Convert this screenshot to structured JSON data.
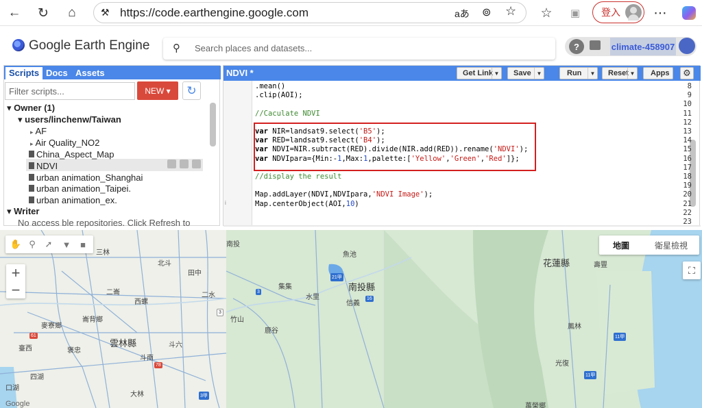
{
  "browser": {
    "url": "https://code.earthengine.google.com",
    "login_label": "登入",
    "read_aloud_glyph": "aあ"
  },
  "app": {
    "title": "Google Earth Engine",
    "search_placeholder": "Search places and datasets...",
    "help_glyph": "?",
    "project": "climate-458907"
  },
  "scripts_panel": {
    "tabs": [
      "Scripts",
      "Docs",
      "Assets"
    ],
    "filter_placeholder": "Filter scripts...",
    "new_label": "NEW",
    "tree": [
      {
        "label": "Owner (1)",
        "level": 0,
        "type": "section",
        "expanded": true
      },
      {
        "label": "users/linchenw/Taiwan",
        "level": 1,
        "type": "repo",
        "expanded": true
      },
      {
        "label": "AF",
        "level": 2,
        "type": "folder"
      },
      {
        "label": "Air Quality_NO2",
        "level": 2,
        "type": "folder"
      },
      {
        "label": "China_Aspect_Map",
        "level": 2,
        "type": "file"
      },
      {
        "label": "NDVI",
        "level": 2,
        "type": "file",
        "selected": true
      },
      {
        "label": "urban animation_Shanghai",
        "level": 2,
        "type": "file"
      },
      {
        "label": "urban animation_Taipei.",
        "level": 2,
        "type": "file"
      },
      {
        "label": "urban animation_ex.",
        "level": 2,
        "type": "file"
      },
      {
        "label": "Writer",
        "level": 0,
        "type": "section",
        "expanded": true
      },
      {
        "label": "No access ble repositories. Click Refresh to",
        "level": 1,
        "type": "note"
      }
    ]
  },
  "editor": {
    "title": "NDVI *",
    "buttons": [
      "Get Link",
      "Save",
      "Run",
      "Reset",
      "Apps"
    ],
    "lines": [
      {
        "n": "8",
        "code": ".mean()"
      },
      {
        "n": "9",
        "code": ".clip(AOI);"
      },
      {
        "n": "10",
        "code": ""
      },
      {
        "n": "11",
        "code": "//Caculate NDVI"
      },
      {
        "n": "12",
        "code": ""
      },
      {
        "n": "13",
        "code": "var NIR=landsat9.select('B5');"
      },
      {
        "n": "14",
        "code": "var RED=landsat9.select('B4');"
      },
      {
        "n": "15",
        "code": "var NDVI=NIR.subtract(RED).divide(NIR.add(RED)).rename('NDVI');"
      },
      {
        "n": "16",
        "code": "var NDVIpara={Min:-1,Max:1,palette:['Yellow','Green','Red']};"
      },
      {
        "n": "17",
        "code": ""
      },
      {
        "n": "18",
        "code": "//display the result"
      },
      {
        "n": "19",
        "code": ""
      },
      {
        "n": "20",
        "code": "Map.addLayer(NDVI,NDVIpara,'NDVI Image');"
      },
      {
        "n": "21",
        "code": "Map.centerObject(AOI,10)"
      },
      {
        "n": "22",
        "code": ""
      },
      {
        "n": "23",
        "code": ""
      }
    ],
    "info_marker_line": "21",
    "highlighted_lines": [
      "13",
      "16"
    ]
  },
  "map": {
    "type_buttons": [
      "地圖",
      "衛星檢視"
    ],
    "active_type": "地圖",
    "labels": [
      {
        "text": "南投縣",
        "big": true
      },
      {
        "text": "花蓮縣",
        "big": true
      },
      {
        "text": "雲林縣",
        "big": true
      },
      {
        "text": "三林"
      },
      {
        "text": "北斗"
      },
      {
        "text": "田中"
      },
      {
        "text": "二崙"
      },
      {
        "text": "西螺"
      },
      {
        "text": "二水"
      },
      {
        "text": "集集"
      },
      {
        "text": "水里"
      },
      {
        "text": "信義"
      },
      {
        "text": "竹山"
      },
      {
        "text": "鹿谷"
      },
      {
        "text": "麥寮鄉"
      },
      {
        "text": "崙背鄉"
      },
      {
        "text": "斗六"
      },
      {
        "text": "臺西"
      },
      {
        "text": "褒忠"
      },
      {
        "text": "斗南"
      },
      {
        "text": "四湖"
      },
      {
        "text": "口湖"
      },
      {
        "text": "大林"
      },
      {
        "text": "南投"
      },
      {
        "text": "魚池"
      },
      {
        "text": "壽豐"
      },
      {
        "text": "鳳林"
      },
      {
        "text": "光復"
      },
      {
        "text": "萬榮鄉"
      },
      {
        "text": "Google"
      }
    ],
    "shields": [
      "21甲",
      "3",
      "3",
      "16",
      "61",
      "78",
      "11甲",
      "11甲",
      "3甲"
    ]
  },
  "colors": {
    "accent_blue": "#4a87e8",
    "new_button": "#d9493b",
    "highlight_box": "#d31f1f",
    "login_red": "#c9302c"
  }
}
